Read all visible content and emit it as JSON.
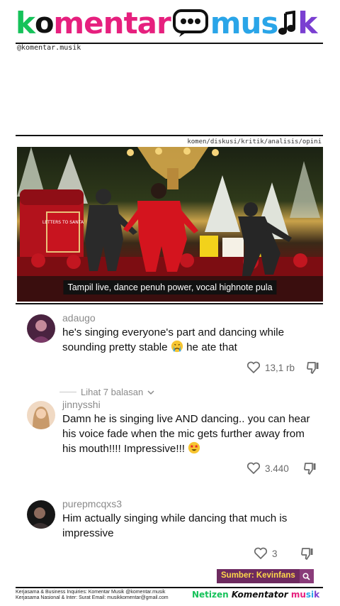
{
  "brand": {
    "logo_parts": [
      "k",
      "o",
      "mentar",
      "mus",
      "k"
    ],
    "handle": "@komentar.musik",
    "tags": "komen/diskusi/kritik/analisis/opini"
  },
  "video": {
    "caption": "Tampil live, dance penuh power, vocal highnote pula",
    "sign_text": "LETTERS TO SANTA"
  },
  "comments": [
    {
      "user": "adaugo",
      "text": "he's singing everyone's part and dancing while sounding pretty stable",
      "text_after": " he ate that",
      "emoji": "crying-face",
      "likes": "13,1 rb"
    },
    {
      "user": "jinnysshi",
      "text": "Damn he is singing live AND dancing.. you can hear his voice fade when the mic gets further away from his mouth!!!! Impressive!!!",
      "emoji": "star-struck-face",
      "likes": "3.440"
    },
    {
      "user": "purepmcqxs3",
      "text": "Him actually singing while dancing that much is impressive",
      "likes": "3"
    }
  ],
  "replies_label": "Lihat 7 balasan",
  "source": {
    "label": "Sumber: Kevinfans"
  },
  "footer": {
    "line1": "Kerjasama & Business Inquiries: Komentar Musik @komentar.musik",
    "line2": "Kerjasama Nasional & Inter: Surat Email: musikkomentar@gmail.com",
    "logo": {
      "a": "Netizen ",
      "b": "Komentator ",
      "c": "mu",
      "d": "si",
      "e": "k"
    }
  },
  "colors": {
    "green": "#16c25a",
    "pink": "#e6207e",
    "blue": "#2aa5e8",
    "orange": "#f2a11a",
    "purple": "#7a3fd1",
    "source_bg": "#6d2a5f",
    "source_text": "#ffd84a"
  }
}
